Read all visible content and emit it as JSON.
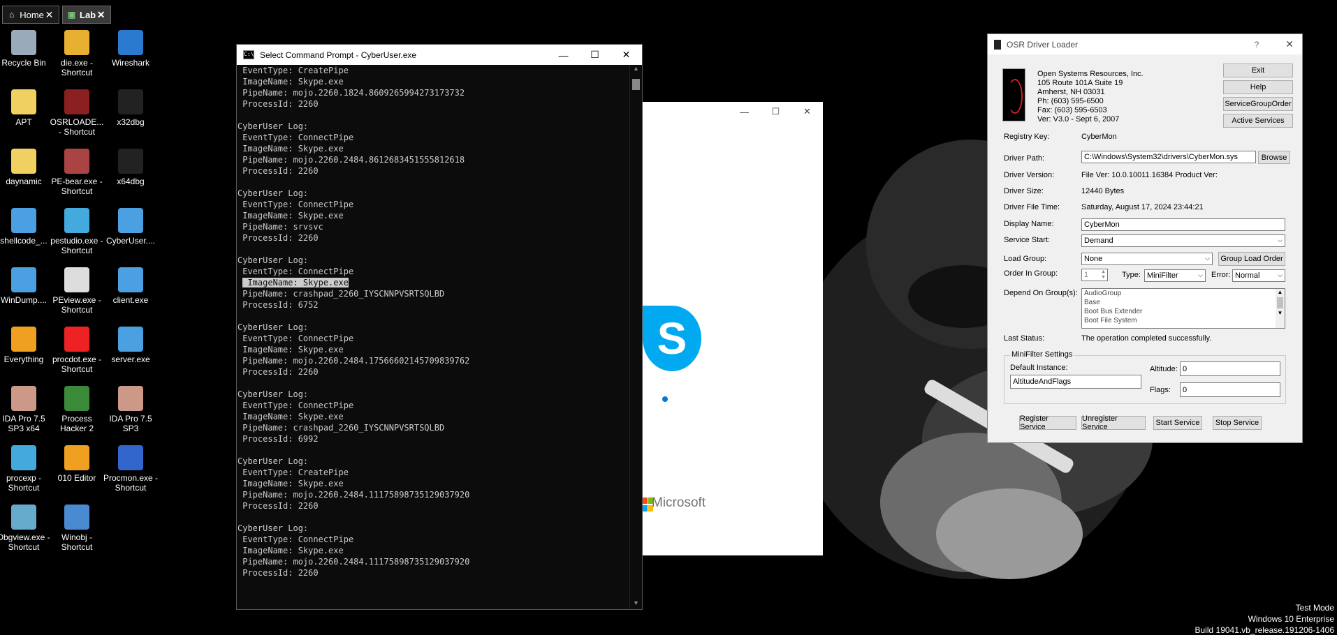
{
  "tabs": [
    {
      "label": "Home",
      "icon": "home-icon"
    },
    {
      "label": "Lab",
      "icon": "vm-icon"
    }
  ],
  "desktop_icons": [
    {
      "label": "Recycle Bin"
    },
    {
      "label": "die.exe - Shortcut"
    },
    {
      "label": "Wireshark"
    },
    {
      "label": "APT"
    },
    {
      "label": "OSRLOADE... - Shortcut"
    },
    {
      "label": "x32dbg"
    },
    {
      "label": "daynamic"
    },
    {
      "label": "PE-bear.exe - Shortcut"
    },
    {
      "label": "x64dbg"
    },
    {
      "label": "shellcode_..."
    },
    {
      "label": "pestudio.exe - Shortcut"
    },
    {
      "label": "CyberUser...."
    },
    {
      "label": "WinDump...."
    },
    {
      "label": "PEview.exe - Shortcut"
    },
    {
      "label": "client.exe"
    },
    {
      "label": "Everything"
    },
    {
      "label": "procdot.exe - Shortcut"
    },
    {
      "label": "server.exe"
    },
    {
      "label": "IDA Pro 7.5 SP3 x64"
    },
    {
      "label": "Process Hacker 2"
    },
    {
      "label": "IDA Pro 7.5 SP3"
    },
    {
      "label": "procexp - Shortcut"
    },
    {
      "label": "010 Editor"
    },
    {
      "label": "Procmon.exe - Shortcut"
    },
    {
      "label": "Dbgview.exe - Shortcut"
    },
    {
      "label": "Winobj - Shortcut"
    }
  ],
  "cmd": {
    "title": "Select Command Prompt - CyberUser.exe",
    "lines": [
      " EventType: CreatePipe",
      " ImageName: Skype.exe",
      " PipeName: mojo.2260.1824.8609265994273173732",
      " ProcessId: 2260",
      "",
      "CyberUser Log:",
      " EventType: ConnectPipe",
      " ImageName: Skype.exe",
      " PipeName: mojo.2260.2484.8612683451555812618",
      " ProcessId: 2260",
      "",
      "CyberUser Log:",
      " EventType: ConnectPipe",
      " ImageName: Skype.exe",
      " PipeName: srvsvc",
      " ProcessId: 2260",
      "",
      "CyberUser Log:",
      " EventType: ConnectPipe",
      " ImageName: Skype.exe",
      " PipeName: crashpad_2260_IYSCNNPVSRTSQLBD",
      " ProcessId: 6752",
      "",
      "CyberUser Log:",
      " EventType: ConnectPipe",
      " ImageName: Skype.exe",
      " PipeName: mojo.2260.2484.17566602145709839762",
      " ProcessId: 2260",
      "",
      "CyberUser Log:",
      " EventType: ConnectPipe",
      " ImageName: Skype.exe",
      " PipeName: crashpad_2260_IYSCNNPVSRTSQLBD",
      " ProcessId: 6992",
      "",
      "CyberUser Log:",
      " EventType: CreatePipe",
      " ImageName: Skype.exe",
      " PipeName: mojo.2260.2484.11175898735129037920",
      " ProcessId: 2260",
      "",
      "CyberUser Log:",
      " EventType: ConnectPipe",
      " ImageName: Skype.exe",
      " PipeName: mojo.2260.2484.11175898735129037920",
      " ProcessId: 2260",
      "",
      "",
      "_"
    ],
    "selected_line_index": 19
  },
  "skype": {
    "logo_letter": "S",
    "footer": "Microsoft"
  },
  "osr": {
    "title": "OSR Driver Loader",
    "help_glyph": "?",
    "company_lines": [
      "Open Systems Resources, Inc.",
      "105 Route 101A Suite 19",
      "Amherst, NH 03031",
      "Ph:  (603) 595-6500",
      "Fax: (603) 595-6503",
      "Ver: V3.0  -  Sept 6, 2007"
    ],
    "buttons": {
      "exit": "Exit",
      "help": "Help",
      "service_group_order": "ServiceGroupOrder",
      "active_services": "Active Services",
      "browse": "Browse",
      "group_load_order": "Group Load Order",
      "register": "Register Service",
      "unregister": "Unregister Service",
      "start": "Start Service",
      "stop": "Stop Service"
    },
    "registry_key_label": "Registry Key:",
    "registry_key": "CyberMon",
    "driver_path_label": "Driver Path:",
    "driver_path": "C:\\Windows\\System32\\drivers\\CyberMon.sys",
    "driver_version_label": "Driver Version:",
    "driver_version": "File Ver: 10.0.10011.16384  Product Ver:",
    "driver_size_label": "Driver Size:",
    "driver_size": "12440 Bytes",
    "driver_time_label": "Driver File Time:",
    "driver_time": "Saturday, August 17, 2024 23:44:21",
    "display_name_label": "Display Name:",
    "display_name": "CyberMon",
    "service_start_label": "Service Start:",
    "service_start": "Demand",
    "load_group_label": "Load Group:",
    "load_group": "None",
    "order_label": "Order In Group:",
    "order_value": "1",
    "type_label": "Type:",
    "type_value": "MiniFilter",
    "error_label": "Error:",
    "error_value": "Normal",
    "depend_label": "Depend On Group(s):",
    "depend_items": [
      "AudioGroup",
      "Base",
      "Boot Bus Extender",
      "Boot File System"
    ],
    "last_status_label": "Last Status:",
    "last_status": "The operation completed successfully.",
    "minifilter_label": "MiniFilter Settings",
    "default_instance_label": "Default Instance:",
    "default_instance": "AltitudeAndFlags",
    "altitude_label": "Altitude:",
    "altitude": "0",
    "flags_label": "Flags:",
    "flags": "0"
  },
  "watermark": {
    "line1": "Test Mode",
    "line2": "Windows 10 Enterprise",
    "line3": "Build 19041.vb_release.191206-1406"
  }
}
